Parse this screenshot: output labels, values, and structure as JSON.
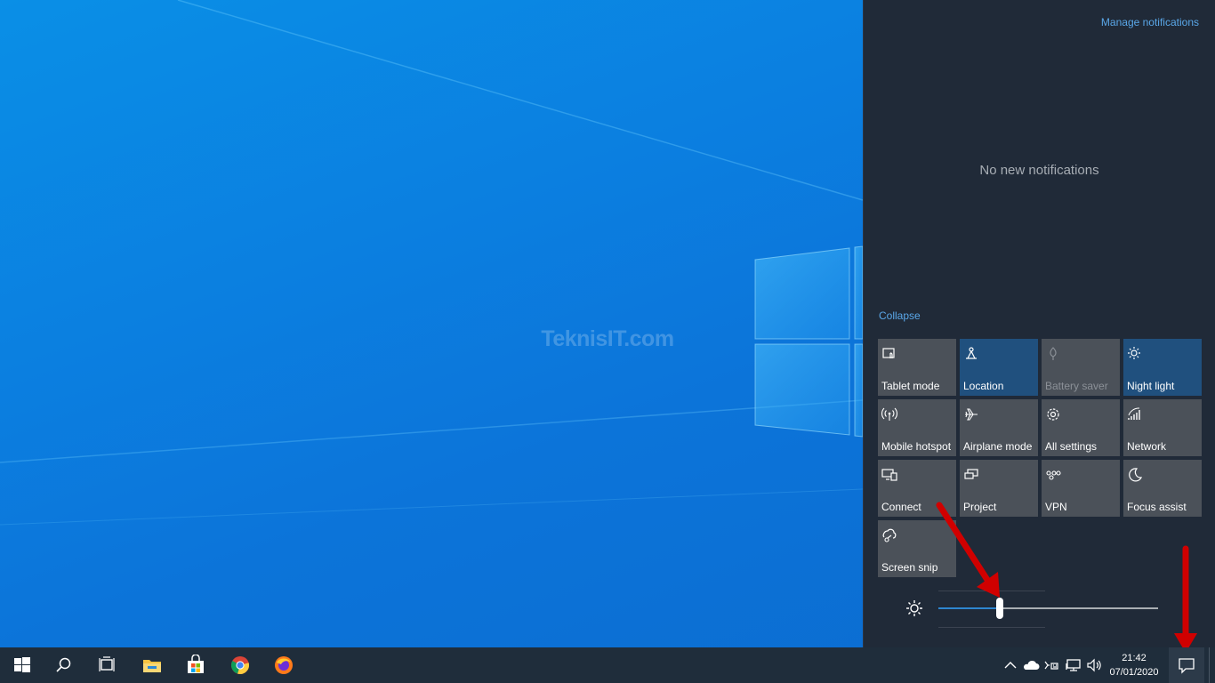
{
  "desktop": {
    "watermark": "TeknisIT.com"
  },
  "action_center": {
    "manage_notifications": "Manage notifications",
    "no_notifications": "No new notifications",
    "collapse": "Collapse",
    "tiles": [
      {
        "label": "Tablet mode",
        "icon": "tablet-mode-icon",
        "state": "off"
      },
      {
        "label": "Location",
        "icon": "location-icon",
        "state": "on"
      },
      {
        "label": "Battery saver",
        "icon": "battery-saver-icon",
        "state": "disabled"
      },
      {
        "label": "Night light",
        "icon": "night-light-icon",
        "state": "on"
      },
      {
        "label": "Mobile hotspot",
        "icon": "mobile-hotspot-icon",
        "state": "off"
      },
      {
        "label": "Airplane mode",
        "icon": "airplane-icon",
        "state": "off"
      },
      {
        "label": "All settings",
        "icon": "settings-gear-icon",
        "state": "off"
      },
      {
        "label": "Network",
        "icon": "network-icon",
        "state": "off"
      },
      {
        "label": "Connect",
        "icon": "connect-icon",
        "state": "off"
      },
      {
        "label": "Project",
        "icon": "project-icon",
        "state": "off"
      },
      {
        "label": "VPN",
        "icon": "vpn-icon",
        "state": "off"
      },
      {
        "label": "Focus assist",
        "icon": "moon-icon",
        "state": "off"
      },
      {
        "label": "Screen snip",
        "icon": "screen-snip-icon",
        "state": "off"
      }
    ],
    "brightness": {
      "icon": "brightness-sun-icon",
      "level": 0.28
    }
  },
  "taskbar": {
    "apps": [
      "start-icon",
      "search-icon",
      "task-view-icon",
      "file-explorer-icon",
      "microsoft-store-icon",
      "chrome-icon",
      "firefox-icon"
    ],
    "tray_icons": [
      "chevron-up-icon",
      "onedrive-cloud-icon",
      "input-keyboard-icon",
      "network-wired-icon",
      "volume-icon"
    ],
    "time": "21:42",
    "date": "07/01/2020",
    "notification_icon": "notification-icon"
  },
  "colors": {
    "accent": "#5aa7e8",
    "tile_on": "#20507e",
    "tile_off": "#4b5159",
    "annotation_arrow": "#d00000"
  }
}
